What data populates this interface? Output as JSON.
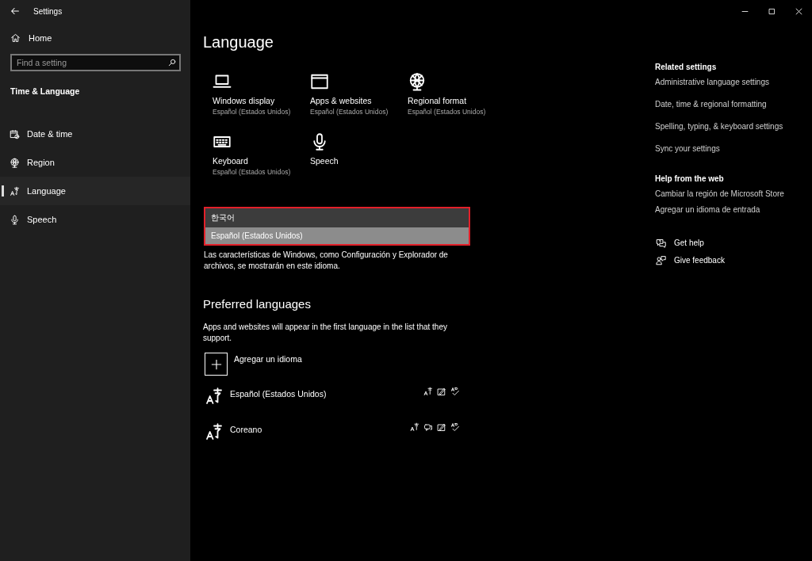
{
  "window": {
    "title": "Settings",
    "controls": [
      {
        "kind": "minimize"
      },
      {
        "kind": "maximize"
      },
      {
        "kind": "close"
      }
    ]
  },
  "sidebar": {
    "home": "Home",
    "search": {
      "placeholder": "Find a setting"
    },
    "section": "Time & Language",
    "items": [
      {
        "label": "Date & time",
        "kind": "calendar",
        "selected": false
      },
      {
        "label": "Region",
        "kind": "globe",
        "selected": false
      },
      {
        "label": "Language",
        "kind": "language",
        "selected": true
      },
      {
        "label": "Speech",
        "kind": "mic",
        "selected": false
      }
    ]
  },
  "page": {
    "title": "Language",
    "tiles": [
      {
        "kind": "laptop",
        "title": "Windows display",
        "subtitle": "Español (Estados Unidos)"
      },
      {
        "kind": "window",
        "title": "Apps & websites",
        "subtitle": "Español (Estados Unidos)"
      },
      {
        "kind": "globe",
        "title": "Regional format",
        "subtitle": "Español (Estados Unidos)"
      },
      {
        "kind": "keyboard",
        "title": "Keyboard",
        "subtitle": "Español (Estados Unidos)"
      },
      {
        "kind": "mic",
        "title": "Speech"
      }
    ],
    "display_language": {
      "highlighted": true,
      "options": [
        {
          "label": "한국어",
          "selected": false
        },
        {
          "label": "Español (Estados Unidos)",
          "selected": true
        }
      ]
    },
    "description": "Las características de Windows, como Configuración y Explorador de archivos, se mostrarán en este idioma.",
    "preferred": {
      "title": "Preferred languages",
      "description": "Apps and websites will appear in the first language in the list that they support.",
      "add": "Agregar un idioma",
      "languages": [
        {
          "name": "Español (Estados Unidos)",
          "features": [
            {
              "kind": "display"
            },
            {
              "kind": "handwriting"
            },
            {
              "kind": "spelling"
            }
          ]
        },
        {
          "name": "Coreano",
          "features": [
            {
              "kind": "display"
            },
            {
              "kind": "speech"
            },
            {
              "kind": "handwriting"
            },
            {
              "kind": "spelling"
            }
          ]
        }
      ]
    }
  },
  "related": {
    "title": "Related settings",
    "links": [
      "Administrative language settings",
      "Date, time & regional formatting",
      "Spelling, typing, & keyboard settings",
      "Sync your settings"
    ]
  },
  "help": {
    "title": "Help from the web",
    "links": [
      "Cambiar la región de Microsoft Store",
      "Agregar un idioma de entrada"
    ]
  },
  "support": [
    {
      "kind": "help",
      "label": "Get help"
    },
    {
      "kind": "feedback",
      "label": "Give feedback"
    }
  ]
}
